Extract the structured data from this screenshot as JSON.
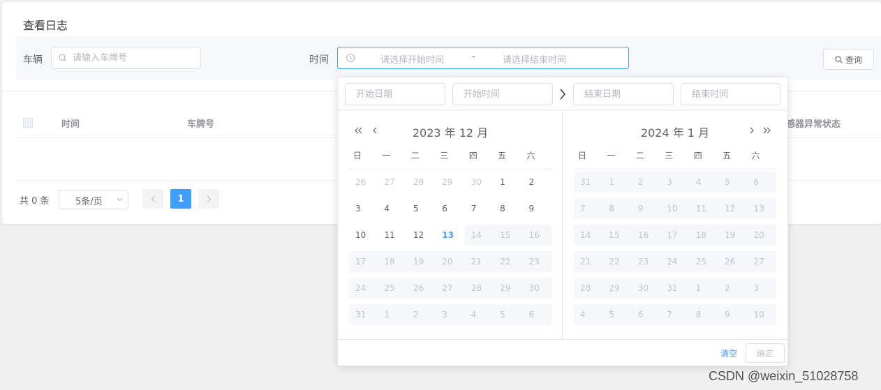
{
  "page": {
    "title": "查看日志"
  },
  "filter": {
    "vehicle_label": "车辆",
    "plate_placeholder": "请输入车牌号",
    "time_label": "时间",
    "start_placeholder": "请选择开始时间",
    "range_separator": "-",
    "end_placeholder": "请选择结束时间",
    "query_label": "查询"
  },
  "table": {
    "columns": [
      "时间",
      "车牌号",
      "传感器异常状态"
    ]
  },
  "pagination": {
    "total_text": "共 0 条",
    "page_size": "5条/页",
    "current_page": "1"
  },
  "picker": {
    "start_date_placeholder": "开始日期",
    "start_time_placeholder": "开始时间",
    "end_date_placeholder": "结束日期",
    "end_time_placeholder": "结束时间",
    "weekdays": [
      "日",
      "一",
      "二",
      "三",
      "四",
      "五",
      "六"
    ],
    "left_month": {
      "title": "2023 年 12 月",
      "weeks": [
        [
          {
            "d": "26",
            "s": "prev"
          },
          {
            "d": "27",
            "s": "prev"
          },
          {
            "d": "28",
            "s": "prev"
          },
          {
            "d": "29",
            "s": "prev"
          },
          {
            "d": "30",
            "s": "prev"
          },
          {
            "d": "1",
            "s": ""
          },
          {
            "d": "2",
            "s": ""
          }
        ],
        [
          {
            "d": "3",
            "s": ""
          },
          {
            "d": "4",
            "s": ""
          },
          {
            "d": "5",
            "s": ""
          },
          {
            "d": "6",
            "s": ""
          },
          {
            "d": "7",
            "s": ""
          },
          {
            "d": "8",
            "s": ""
          },
          {
            "d": "9",
            "s": ""
          }
        ],
        [
          {
            "d": "10",
            "s": ""
          },
          {
            "d": "11",
            "s": ""
          },
          {
            "d": "12",
            "s": ""
          },
          {
            "d": "13",
            "s": "today"
          },
          {
            "d": "14",
            "s": "dis"
          },
          {
            "d": "15",
            "s": "dis"
          },
          {
            "d": "16",
            "s": "dis"
          }
        ],
        [
          {
            "d": "17",
            "s": "dis"
          },
          {
            "d": "18",
            "s": "dis"
          },
          {
            "d": "19",
            "s": "dis"
          },
          {
            "d": "20",
            "s": "dis"
          },
          {
            "d": "21",
            "s": "dis"
          },
          {
            "d": "22",
            "s": "dis"
          },
          {
            "d": "23",
            "s": "dis"
          }
        ],
        [
          {
            "d": "24",
            "s": "dis"
          },
          {
            "d": "25",
            "s": "dis"
          },
          {
            "d": "26",
            "s": "dis"
          },
          {
            "d": "27",
            "s": "dis"
          },
          {
            "d": "28",
            "s": "dis"
          },
          {
            "d": "29",
            "s": "dis"
          },
          {
            "d": "30",
            "s": "dis"
          }
        ],
        [
          {
            "d": "31",
            "s": "dis"
          },
          {
            "d": "1",
            "s": "dis"
          },
          {
            "d": "2",
            "s": "dis"
          },
          {
            "d": "3",
            "s": "dis"
          },
          {
            "d": "4",
            "s": "dis"
          },
          {
            "d": "5",
            "s": "dis"
          },
          {
            "d": "6",
            "s": "dis"
          }
        ]
      ]
    },
    "right_month": {
      "title": "2024 年 1 月",
      "weeks": [
        [
          {
            "d": "31",
            "s": "dis"
          },
          {
            "d": "1",
            "s": "dis"
          },
          {
            "d": "2",
            "s": "dis"
          },
          {
            "d": "3",
            "s": "dis"
          },
          {
            "d": "4",
            "s": "dis"
          },
          {
            "d": "5",
            "s": "dis"
          },
          {
            "d": "6",
            "s": "dis"
          }
        ],
        [
          {
            "d": "7",
            "s": "dis"
          },
          {
            "d": "8",
            "s": "dis"
          },
          {
            "d": "9",
            "s": "dis"
          },
          {
            "d": "10",
            "s": "dis"
          },
          {
            "d": "11",
            "s": "dis"
          },
          {
            "d": "12",
            "s": "dis"
          },
          {
            "d": "13",
            "s": "dis"
          }
        ],
        [
          {
            "d": "14",
            "s": "dis"
          },
          {
            "d": "15",
            "s": "dis"
          },
          {
            "d": "16",
            "s": "dis"
          },
          {
            "d": "17",
            "s": "dis"
          },
          {
            "d": "18",
            "s": "dis"
          },
          {
            "d": "19",
            "s": "dis"
          },
          {
            "d": "20",
            "s": "dis"
          }
        ],
        [
          {
            "d": "21",
            "s": "dis"
          },
          {
            "d": "22",
            "s": "dis"
          },
          {
            "d": "23",
            "s": "dis"
          },
          {
            "d": "24",
            "s": "dis"
          },
          {
            "d": "25",
            "s": "dis"
          },
          {
            "d": "26",
            "s": "dis"
          },
          {
            "d": "27",
            "s": "dis"
          }
        ],
        [
          {
            "d": "28",
            "s": "dis"
          },
          {
            "d": "29",
            "s": "dis"
          },
          {
            "d": "30",
            "s": "dis"
          },
          {
            "d": "31",
            "s": "dis"
          },
          {
            "d": "1",
            "s": "dis"
          },
          {
            "d": "2",
            "s": "dis"
          },
          {
            "d": "3",
            "s": "dis"
          }
        ],
        [
          {
            "d": "4",
            "s": "dis"
          },
          {
            "d": "5",
            "s": "dis"
          },
          {
            "d": "6",
            "s": "dis"
          },
          {
            "d": "7",
            "s": "dis"
          },
          {
            "d": "8",
            "s": "dis"
          },
          {
            "d": "9",
            "s": "dis"
          },
          {
            "d": "10",
            "s": "dis"
          }
        ]
      ]
    },
    "clear_label": "清空",
    "confirm_label": "确定"
  },
  "watermark": "CSDN @weixin_51028758",
  "colors": {
    "accent": "#409eff",
    "muted": "#c0c4cc",
    "disabled_bg": "#f5f7fa"
  },
  "icons": [
    "search-icon",
    "clock-icon",
    "double-chevron-left-icon",
    "chevron-left-icon",
    "chevron-right-icon",
    "double-chevron-right-icon",
    "arrow-right-icon",
    "chevron-down-icon"
  ]
}
